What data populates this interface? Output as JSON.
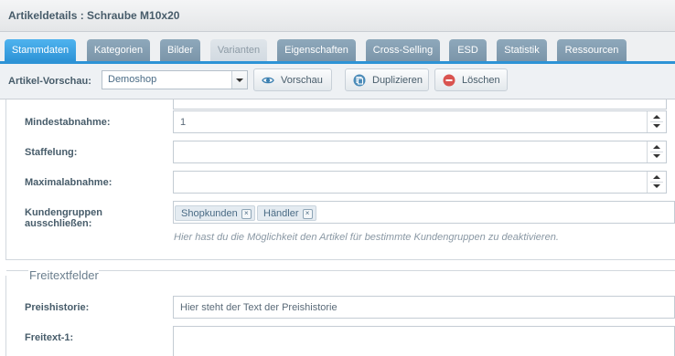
{
  "window": {
    "title": "Artikeldetails : Schraube M10x20"
  },
  "tabs": [
    {
      "label": "Stammdaten",
      "state": "active"
    },
    {
      "label": "Kategorien",
      "state": "normal"
    },
    {
      "label": "Bilder",
      "state": "normal"
    },
    {
      "label": "Varianten",
      "state": "disabled"
    },
    {
      "label": "Eigenschaften",
      "state": "normal"
    },
    {
      "label": "Cross-Selling",
      "state": "normal"
    },
    {
      "label": "ESD",
      "state": "normal"
    },
    {
      "label": "Statistik",
      "state": "normal"
    },
    {
      "label": "Ressourcen",
      "state": "normal"
    }
  ],
  "toolbar": {
    "preview_label": "Artikel-Vorschau:",
    "shop_value": "Demoshop",
    "preview_button": "Vorschau",
    "duplicate_button": "Duplizieren",
    "delete_button": "Löschen"
  },
  "form": {
    "min_purchase": {
      "label": "Mindestabnahme:",
      "value": "1"
    },
    "graduation": {
      "label": "Staffelung:",
      "value": ""
    },
    "max_purchase": {
      "label": "Maximalabnahme:",
      "value": ""
    },
    "customer_groups": {
      "label_line1": "Kundengruppen",
      "label_line2": "ausschließen:",
      "tags": [
        "Shopkunden",
        "Händler"
      ],
      "help": "Hier hast du die Möglichkeit den Artikel für bestimmte Kundengruppen zu deaktivieren."
    }
  },
  "freetext": {
    "legend": "Freitextfelder",
    "price_history": {
      "label": "Preishistorie:",
      "value": "Hier steht der Text der Preishistorie"
    },
    "freetext1": {
      "label": "Freitext-1:",
      "value": ""
    }
  },
  "colors": {
    "accent": "#2d93d6",
    "tab_inactive": "#7b95a9",
    "delete_icon": "#d9534f"
  }
}
